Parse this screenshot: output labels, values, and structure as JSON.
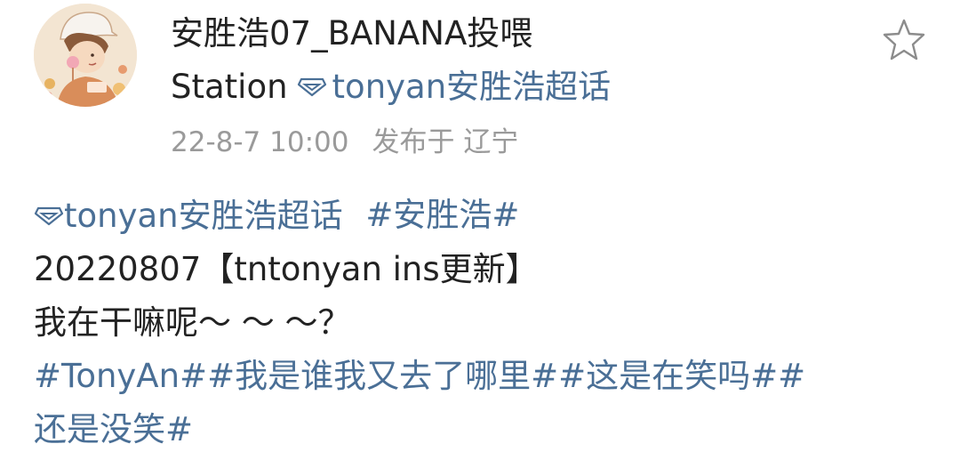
{
  "post": {
    "author": {
      "name": "安胜浩07_BANANA投喂",
      "avatar_icon": "avatar-illustration"
    },
    "station_label": "Station",
    "super_topic": "tonyan安胜浩超话",
    "time": "22-8-7 10:00",
    "location_text": "发布于 辽宁",
    "favorite_icon": "star-icon",
    "body": {
      "line1": {
        "topic": "tonyan安胜浩超话",
        "hashtag": "#安胜浩#"
      },
      "line2": "20220807【tntonyan ins更新】",
      "line3": "我在干嘛呢～ ～ ～？",
      "line4": "#TonyAn##我是谁我又去了哪里##这是在笑吗##",
      "line5": "还是没笑#"
    }
  },
  "colors": {
    "link": "#4a6f96",
    "text": "#222222",
    "meta": "#9a9a9a",
    "star_outline": "#8c8c8c"
  }
}
